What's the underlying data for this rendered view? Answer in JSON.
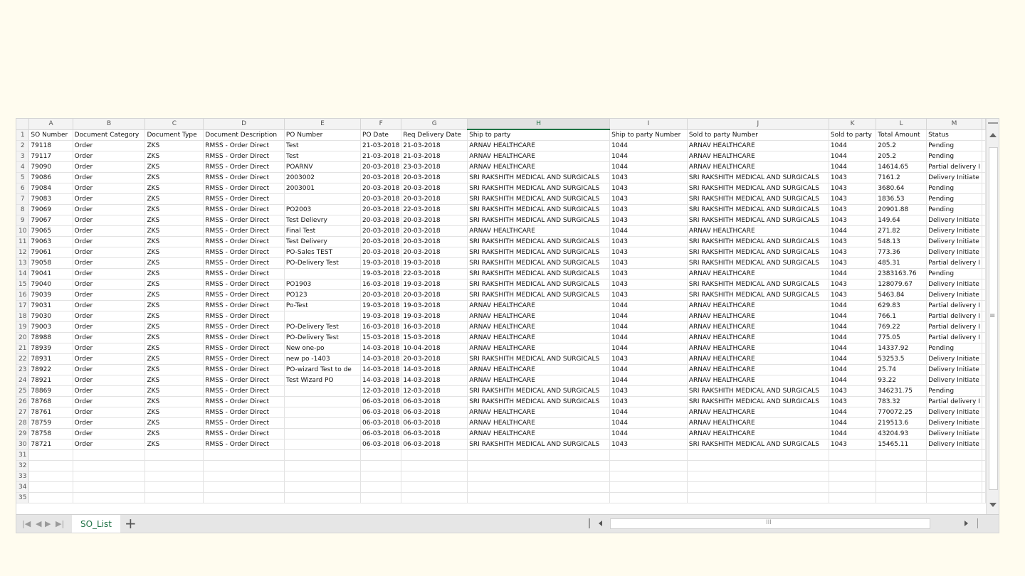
{
  "sheet": {
    "columns": [
      "A",
      "B",
      "C",
      "D",
      "E",
      "F",
      "G",
      "H",
      "I",
      "J",
      "K",
      "L",
      "M"
    ],
    "selected_column": "H",
    "rows": [
      [
        "SO Number",
        "Document Category",
        "Document Type",
        "Document Description",
        "PO Number",
        "PO Date",
        "Req Delivery Date",
        "Ship to party",
        "Ship to party Number",
        "Sold to party Number",
        "Sold to party",
        "Total Amount",
        "Status"
      ],
      [
        "79118",
        "Order",
        "ZKS",
        "RMSS - Order Direct",
        "Test",
        "21-03-2018",
        "21-03-2018",
        "ARNAV HEALTHCARE",
        "1044",
        "ARNAV HEALTHCARE",
        "1044",
        "205.2",
        "Pending"
      ],
      [
        "79117",
        "Order",
        "ZKS",
        "RMSS - Order Direct",
        "Test",
        "21-03-2018",
        "21-03-2018",
        "ARNAV HEALTHCARE",
        "1044",
        "ARNAV HEALTHCARE",
        "1044",
        "205.2",
        "Pending"
      ],
      [
        "79090",
        "Order",
        "ZKS",
        "RMSS - Order Direct",
        "POARNV",
        "20-03-2018",
        "23-03-2018",
        "ARNAV HEALTHCARE",
        "1044",
        "ARNAV HEALTHCARE",
        "1044",
        "14614.65",
        "Partial delivery I"
      ],
      [
        "79086",
        "Order",
        "ZKS",
        "RMSS - Order Direct",
        "2003002",
        "20-03-2018",
        "20-03-2018",
        "SRI RAKSHITH MEDICAL AND SURGICALS",
        "1043",
        "SRI RAKSHITH MEDICAL AND SURGICALS",
        "1043",
        "7161.2",
        "Delivery Initiate"
      ],
      [
        "79084",
        "Order",
        "ZKS",
        "RMSS - Order Direct",
        "2003001",
        "20-03-2018",
        "20-03-2018",
        "SRI RAKSHITH MEDICAL AND SURGICALS",
        "1043",
        "SRI RAKSHITH MEDICAL AND SURGICALS",
        "1043",
        "3680.64",
        "Pending"
      ],
      [
        "79083",
        "Order",
        "ZKS",
        "RMSS - Order Direct",
        "",
        "20-03-2018",
        "20-03-2018",
        "SRI RAKSHITH MEDICAL AND SURGICALS",
        "1043",
        "SRI RAKSHITH MEDICAL AND SURGICALS",
        "1043",
        "1836.53",
        "Pending"
      ],
      [
        "79069",
        "Order",
        "ZKS",
        "RMSS - Order Direct",
        "PO2003",
        "20-03-2018",
        "22-03-2018",
        "SRI RAKSHITH MEDICAL AND SURGICALS",
        "1043",
        "SRI RAKSHITH MEDICAL AND SURGICALS",
        "1043",
        "20901.88",
        "Pending"
      ],
      [
        "79067",
        "Order",
        "ZKS",
        "RMSS - Order Direct",
        "Test Delievry",
        "20-03-2018",
        "20-03-2018",
        "SRI RAKSHITH MEDICAL AND SURGICALS",
        "1043",
        "SRI RAKSHITH MEDICAL AND SURGICALS",
        "1043",
        "149.64",
        "Delivery Initiate"
      ],
      [
        "79065",
        "Order",
        "ZKS",
        "RMSS - Order Direct",
        "Final Test",
        "20-03-2018",
        "20-03-2018",
        "ARNAV HEALTHCARE",
        "1044",
        "ARNAV HEALTHCARE",
        "1044",
        "271.82",
        "Delivery Initiate"
      ],
      [
        "79063",
        "Order",
        "ZKS",
        "RMSS - Order Direct",
        "Test Delivery",
        "20-03-2018",
        "20-03-2018",
        "SRI RAKSHITH MEDICAL AND SURGICALS",
        "1043",
        "SRI RAKSHITH MEDICAL AND SURGICALS",
        "1043",
        "548.13",
        "Delivery Initiate"
      ],
      [
        "79061",
        "Order",
        "ZKS",
        "RMSS - Order Direct",
        "PO-Sales TEST",
        "20-03-2018",
        "20-03-2018",
        "SRI RAKSHITH MEDICAL AND SURGICALS",
        "1043",
        "SRI RAKSHITH MEDICAL AND SURGICALS",
        "1043",
        "773.36",
        "Delivery Initiate"
      ],
      [
        "79058",
        "Order",
        "ZKS",
        "RMSS - Order Direct",
        "PO-Delivery Test",
        "19-03-2018",
        "19-03-2018",
        "SRI RAKSHITH MEDICAL AND SURGICALS",
        "1043",
        "SRI RAKSHITH MEDICAL AND SURGICALS",
        "1043",
        "485.31",
        "Partial delivery I"
      ],
      [
        "79041",
        "Order",
        "ZKS",
        "RMSS - Order Direct",
        "",
        "19-03-2018",
        "22-03-2018",
        "SRI RAKSHITH MEDICAL AND SURGICALS",
        "1043",
        "ARNAV HEALTHCARE",
        "1044",
        "2383163.76",
        "Pending"
      ],
      [
        "79040",
        "Order",
        "ZKS",
        "RMSS - Order Direct",
        "PO1903",
        "16-03-2018",
        "19-03-2018",
        "SRI RAKSHITH MEDICAL AND SURGICALS",
        "1043",
        "SRI RAKSHITH MEDICAL AND SURGICALS",
        "1043",
        "128079.67",
        "Delivery Initiate"
      ],
      [
        "79039",
        "Order",
        "ZKS",
        "RMSS - Order Direct",
        "PO123",
        "20-03-2018",
        "20-03-2018",
        "SRI RAKSHITH MEDICAL AND SURGICALS",
        "1043",
        "SRI RAKSHITH MEDICAL AND SURGICALS",
        "1043",
        "5463.84",
        "Delivery Initiate"
      ],
      [
        "79031",
        "Order",
        "ZKS",
        "RMSS - Order Direct",
        "Po-Test",
        "19-03-2018",
        "19-03-2018",
        "ARNAV HEALTHCARE",
        "1044",
        "ARNAV HEALTHCARE",
        "1044",
        "629.83",
        "Partial delivery I"
      ],
      [
        "79030",
        "Order",
        "ZKS",
        "RMSS - Order Direct",
        "",
        "19-03-2018",
        "19-03-2018",
        "ARNAV HEALTHCARE",
        "1044",
        "ARNAV HEALTHCARE",
        "1044",
        "766.1",
        "Partial delivery I"
      ],
      [
        "79003",
        "Order",
        "ZKS",
        "RMSS - Order Direct",
        "PO-Delivery Test",
        "16-03-2018",
        "16-03-2018",
        "ARNAV HEALTHCARE",
        "1044",
        "ARNAV HEALTHCARE",
        "1044",
        "769.22",
        "Partial delivery I"
      ],
      [
        "78988",
        "Order",
        "ZKS",
        "RMSS - Order Direct",
        "PO-Delivery Test",
        "15-03-2018",
        "15-03-2018",
        "ARNAV HEALTHCARE",
        "1044",
        "ARNAV HEALTHCARE",
        "1044",
        "775.05",
        "Partial delivery I"
      ],
      [
        "78939",
        "Order",
        "ZKS",
        "RMSS - Order Direct",
        "New one-po",
        "14-03-2018",
        "10-04-2018",
        "ARNAV HEALTHCARE",
        "1044",
        "ARNAV HEALTHCARE",
        "1044",
        "14337.92",
        "Pending"
      ],
      [
        "78931",
        "Order",
        "ZKS",
        "RMSS - Order Direct",
        "new po -1403",
        "14-03-2018",
        "20-03-2018",
        "SRI RAKSHITH MEDICAL AND SURGICALS",
        "1043",
        "ARNAV HEALTHCARE",
        "1044",
        "53253.5",
        "Delivery Initiate"
      ],
      [
        "78922",
        "Order",
        "ZKS",
        "RMSS - Order Direct",
        "PO-wizard Test to de",
        "14-03-2018",
        "14-03-2018",
        "ARNAV HEALTHCARE",
        "1044",
        "ARNAV HEALTHCARE",
        "1044",
        "25.74",
        "Delivery Initiate"
      ],
      [
        "78921",
        "Order",
        "ZKS",
        "RMSS - Order Direct",
        "Test Wizard PO",
        "14-03-2018",
        "14-03-2018",
        "ARNAV HEALTHCARE",
        "1044",
        "ARNAV HEALTHCARE",
        "1044",
        "93.22",
        "Delivery Initiate"
      ],
      [
        "78869",
        "Order",
        "ZKS",
        "RMSS - Order Direct",
        "",
        "12-03-2018",
        "12-03-2018",
        "SRI RAKSHITH MEDICAL AND SURGICALS",
        "1043",
        "SRI RAKSHITH MEDICAL AND SURGICALS",
        "1043",
        "346231.75",
        "Pending"
      ],
      [
        "78768",
        "Order",
        "ZKS",
        "RMSS - Order Direct",
        "",
        "06-03-2018",
        "06-03-2018",
        "SRI RAKSHITH MEDICAL AND SURGICALS",
        "1043",
        "SRI RAKSHITH MEDICAL AND SURGICALS",
        "1043",
        "783.32",
        "Partial delivery I"
      ],
      [
        "78761",
        "Order",
        "ZKS",
        "RMSS - Order Direct",
        "",
        "06-03-2018",
        "06-03-2018",
        "ARNAV HEALTHCARE",
        "1044",
        "ARNAV HEALTHCARE",
        "1044",
        "770072.25",
        "Delivery Initiate"
      ],
      [
        "78759",
        "Order",
        "ZKS",
        "RMSS - Order Direct",
        "",
        "06-03-2018",
        "06-03-2018",
        "ARNAV HEALTHCARE",
        "1044",
        "ARNAV HEALTHCARE",
        "1044",
        "219513.6",
        "Delivery Initiate"
      ],
      [
        "78758",
        "Order",
        "ZKS",
        "RMSS - Order Direct",
        "",
        "06-03-2018",
        "06-03-2018",
        "ARNAV HEALTHCARE",
        "1044",
        "ARNAV HEALTHCARE",
        "1044",
        "43204.93",
        "Delivery Initiate"
      ],
      [
        "78721",
        "Order",
        "ZKS",
        "RMSS - Order Direct",
        "",
        "06-03-2018",
        "06-03-2018",
        "SRI RAKSHITH MEDICAL AND SURGICALS",
        "1043",
        "SRI RAKSHITH MEDICAL AND SURGICALS",
        "1043",
        "15465.11",
        "Delivery Initiate"
      ],
      [
        "",
        "",
        "",
        "",
        "",
        "",
        "",
        "",
        "",
        "",
        "",
        "",
        ""
      ],
      [
        "",
        "",
        "",
        "",
        "",
        "",
        "",
        "",
        "",
        "",
        "",
        "",
        ""
      ],
      [
        "",
        "",
        "",
        "",
        "",
        "",
        "",
        "",
        "",
        "",
        "",
        "",
        ""
      ],
      [
        "",
        "",
        "",
        "",
        "",
        "",
        "",
        "",
        "",
        "",
        "",
        "",
        ""
      ],
      [
        "",
        "",
        "",
        "",
        "",
        "",
        "",
        "",
        "",
        "",
        "",
        "",
        ""
      ]
    ]
  },
  "tabbar": {
    "sheet_tab": "SO_List",
    "add_sheet": "+"
  },
  "colors": {
    "accent": "#217346",
    "page_background": "#fffcef"
  },
  "icons": {
    "nav": [
      "first-sheet-icon",
      "prev-sheet-icon",
      "next-sheet-icon",
      "last-sheet-icon"
    ]
  }
}
